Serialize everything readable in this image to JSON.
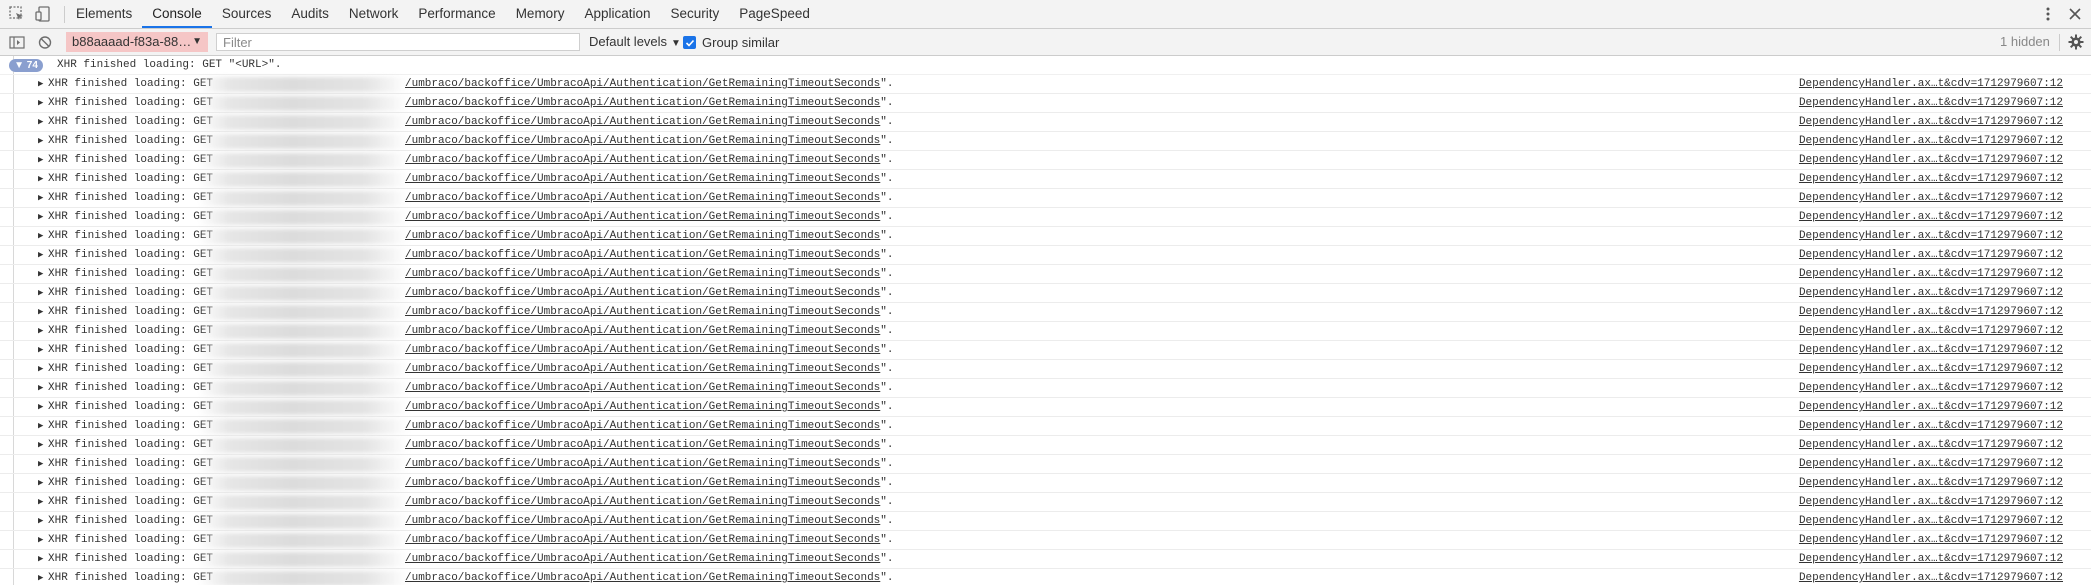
{
  "devtools": {
    "tabs": [
      {
        "label": "Elements",
        "active": false
      },
      {
        "label": "Console",
        "active": true
      },
      {
        "label": "Sources",
        "active": false
      },
      {
        "label": "Audits",
        "active": false
      },
      {
        "label": "Network",
        "active": false
      },
      {
        "label": "Performance",
        "active": false
      },
      {
        "label": "Memory",
        "active": false
      },
      {
        "label": "Application",
        "active": false
      },
      {
        "label": "Security",
        "active": false
      },
      {
        "label": "PageSpeed",
        "active": false
      }
    ],
    "accent_color": "#1a73e8"
  },
  "toolbar": {
    "context": "b88aaaad-f83a-88…",
    "filter_placeholder": "Filter",
    "filter_value": "",
    "levels_label": "Default levels",
    "group_similar_label": "Group similar",
    "group_similar_checked": true,
    "hidden_count": "1 hidden"
  },
  "log": {
    "group_count": "74",
    "group_message": "XHR finished loading: GET \"<URL>\".",
    "entry_prefix": "XHR finished loading: GET",
    "entry_path": "/umbraco/backoffice/UmbracoApi/Authentication/GetRemainingTimeoutSeconds",
    "entry_suffix": "\".",
    "entry_source": "DependencyHandler.ax…t&cdv=1712979607:12",
    "entry_count": 27
  }
}
